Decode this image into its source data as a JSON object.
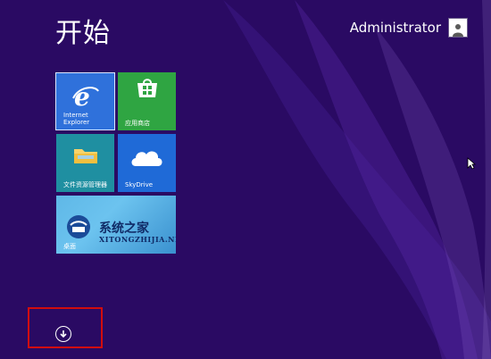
{
  "start": {
    "title": "开始"
  },
  "user": {
    "name": "Administrator"
  },
  "tiles": [
    {
      "name": "Internet Explorer",
      "label_line1": "Internet",
      "label_line2": "Explorer"
    },
    {
      "name": "应用商店",
      "label": "应用商店"
    },
    {
      "name": "文件资源管理器",
      "label": "文件资源管理器"
    },
    {
      "name": "SkyDrive",
      "label": "SkyDrive"
    },
    {
      "name": "桌面",
      "label": "桌面"
    }
  ],
  "desktop_overlay": {
    "brand": "系统之家",
    "url": "XITONGZHIJIA.NET"
  },
  "icons": {
    "apps_button": "down-arrow-circle-icon",
    "user_avatar": "user-avatar-icon"
  },
  "colors": {
    "background": "#2a0a63",
    "ie_tile": "#2f71db",
    "store_tile": "#2fa542",
    "explorer_tile": "#1f8fa1",
    "onedrive_tile": "#1f6ad7",
    "highlight": "#d20d0d"
  }
}
